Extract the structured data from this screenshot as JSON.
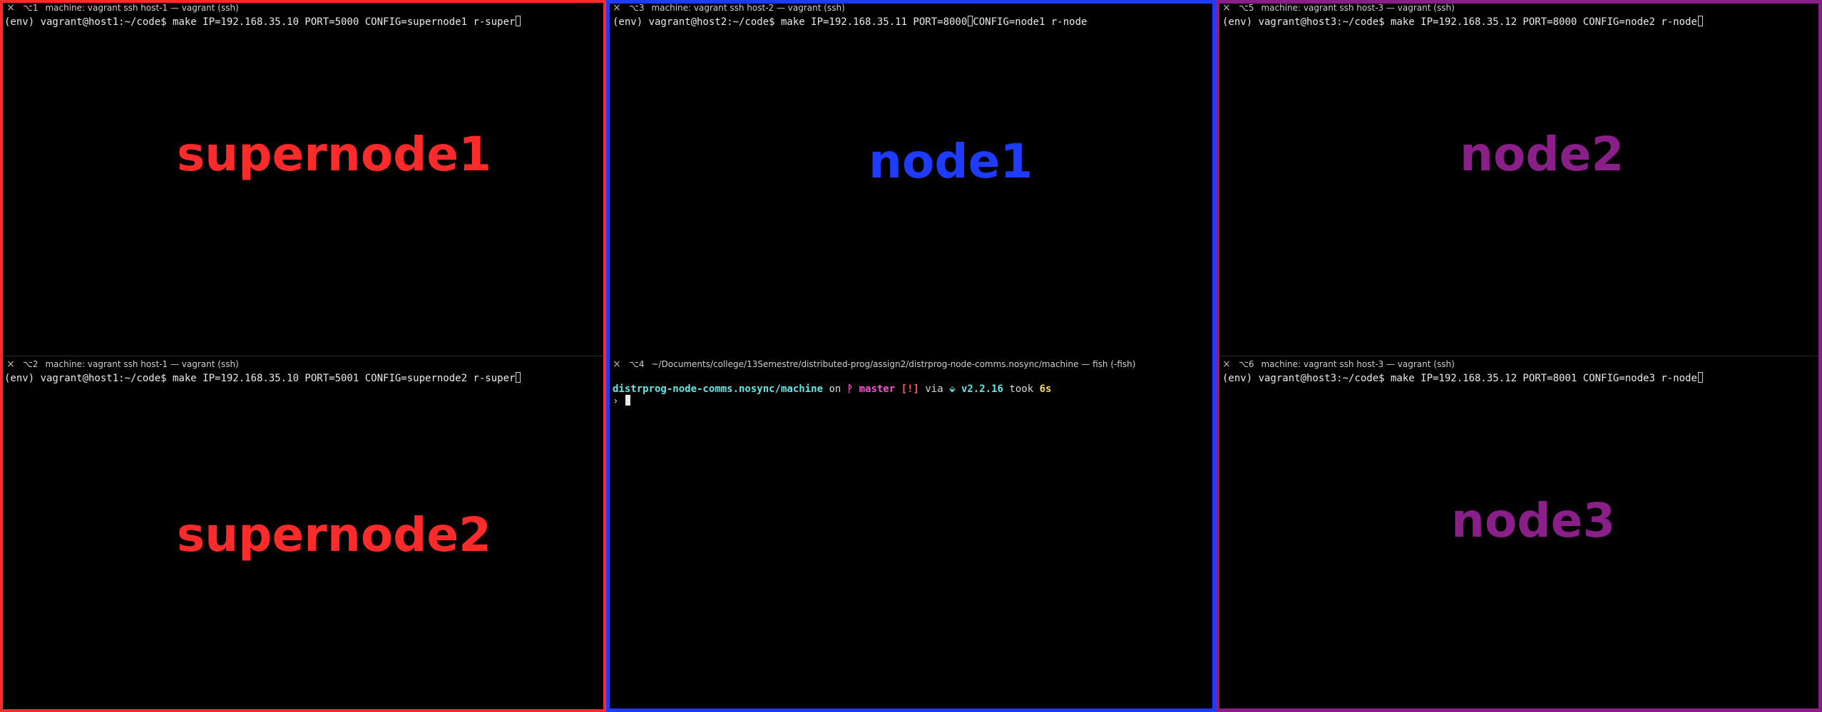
{
  "colors": {
    "red": "#ff2a2a",
    "blue": "#1e3cff",
    "purple": "#8a1f8a"
  },
  "panes": {
    "p1": {
      "close_icon": "×",
      "tab_key": "⌥1",
      "title": "machine: vagrant ssh host-1 — vagrant (ssh)",
      "command": "(env) vagrant@host1:~/code$ make IP=192.168.35.10 PORT=5000 CONFIG=supernode1 r-super",
      "label": "supernode1"
    },
    "p2": {
      "close_icon": "×",
      "tab_key": "⌥2",
      "title": "machine: vagrant ssh host-1 — vagrant (ssh)",
      "command": "(env) vagrant@host1:~/code$ make IP=192.168.35.10 PORT=5001 CONFIG=supernode2 r-super",
      "label": "supernode2"
    },
    "p3": {
      "close_icon": "×",
      "tab_key": "⌥3",
      "title": "machine: vagrant ssh host-2 — vagrant (ssh)",
      "command_before_cursor": "(env) vagrant@host2:~/code$ make IP=192.168.35.11 PORT=8000",
      "command_after_cursor": "CONFIG=node1 r-node",
      "label": "node1"
    },
    "p4": {
      "close_icon": "×",
      "tab_key": "⌥4",
      "title": "~/Documents/college/13Semestre/distributed-prog/assign2/distrprog-node-comms.nosync/machine — fish (-fish)",
      "prompt": {
        "path": "distrprog-node-comms.nosync/machine",
        "on": "on",
        "branch_icon": "ᚹ",
        "branch": "master",
        "status": "[!]",
        "via": "via",
        "lang_icon": "⬙",
        "version": "v2.2.16",
        "took": "took",
        "duration": "6s",
        "caret": "›"
      }
    },
    "p5": {
      "close_icon": "×",
      "tab_key": "⌥5",
      "title": "machine: vagrant ssh host-3 — vagrant (ssh)",
      "command": "(env) vagrant@host3:~/code$ make IP=192.168.35.12 PORT=8000 CONFIG=node2 r-node",
      "label": "node2"
    },
    "p6": {
      "close_icon": "×",
      "tab_key": "⌥6",
      "title": "machine: vagrant ssh host-3 — vagrant (ssh)",
      "command": "(env) vagrant@host3:~/code$ make IP=192.168.35.12 PORT=8001 CONFIG=node3 r-node",
      "label": "node3"
    }
  }
}
